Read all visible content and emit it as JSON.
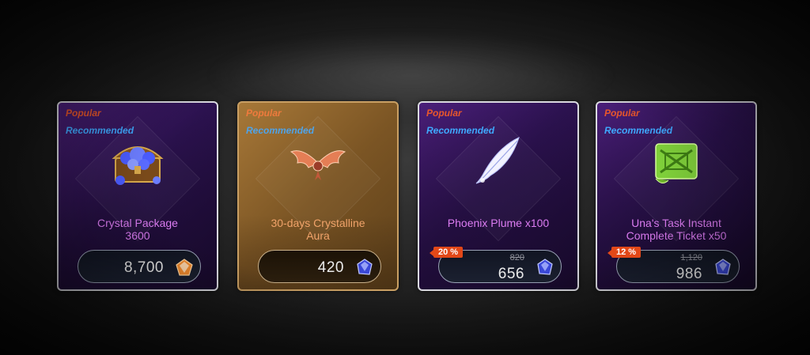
{
  "shop": {
    "cards": [
      {
        "style": "purple",
        "popular": "Popular",
        "recommended": "Recommended",
        "title_line1": "Crystal Package",
        "title_line2": "3600",
        "price": "8,700",
        "currency_icon": "orange-gem-icon",
        "item_icon": "crystal-chest-icon"
      },
      {
        "style": "gold",
        "popular": "Popular",
        "recommended": "Recommended",
        "title_line1": "30-days Crystalline",
        "title_line2": "Aura",
        "price": "420",
        "currency_icon": "blue-crystal-icon",
        "item_icon": "winged-aura-icon"
      },
      {
        "style": "purple",
        "popular": "Popular",
        "recommended": "Recommended",
        "title_line1": "Phoenix Plume x100",
        "title_line2": "",
        "discount": "20 %",
        "old_price": "820",
        "price": "656",
        "currency_icon": "blue-crystal-icon",
        "item_icon": "white-feather-icon"
      },
      {
        "style": "purple",
        "popular": "Popular",
        "recommended": "Recommended",
        "title_line1": "Una's Task Instant",
        "title_line2": "Complete Ticket x50",
        "discount": "12 %",
        "old_price": "1,120",
        "price": "986",
        "currency_icon": "blue-crystal-icon",
        "item_icon": "green-scroll-icon"
      }
    ],
    "colors": {
      "popular": "#e9572b",
      "recommended": "#3fa9ff",
      "title_purple": "#dc7cf2",
      "title_gold": "#f1a36a",
      "discount": "#e24818"
    }
  }
}
